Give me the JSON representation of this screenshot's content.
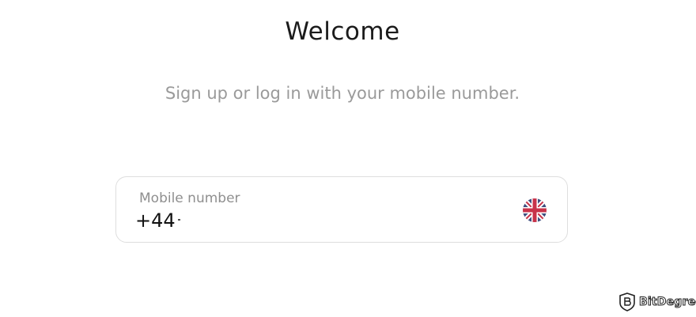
{
  "header": {
    "title": "Welcome",
    "subtitle": "Sign up or log in with your mobile number."
  },
  "phone_field": {
    "label": "Mobile number",
    "value": "+44",
    "country_flag_icon": "uk-flag-icon"
  },
  "watermark": {
    "text": "BitDegree"
  },
  "colors": {
    "title": "#1b1b1b",
    "subtitle": "#9a9a9a",
    "field_border": "#dedede",
    "flag_blue": "#3f4f7f",
    "flag_red": "#c8334a"
  }
}
